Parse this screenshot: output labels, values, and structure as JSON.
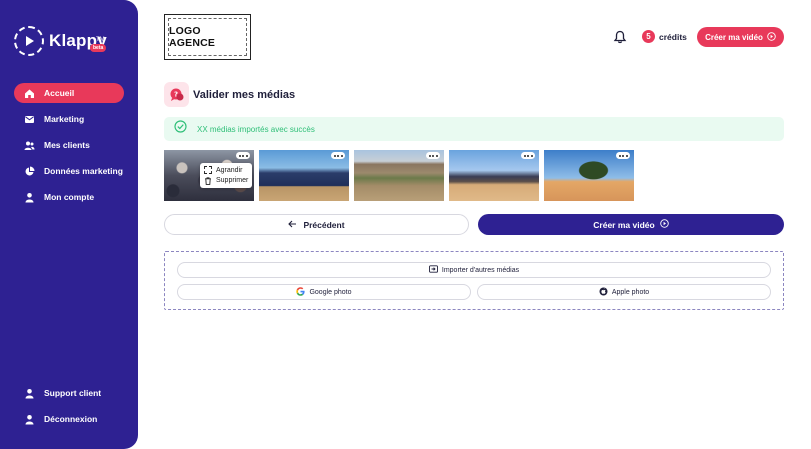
{
  "app": {
    "brand": "Klappy",
    "brand_tm": "TM",
    "brand_badge": "beta"
  },
  "sidebar": {
    "items": [
      {
        "label": "Accueil",
        "icon": "home-icon",
        "active": true
      },
      {
        "label": "Marketing",
        "icon": "mail-icon",
        "active": false
      },
      {
        "label": "Mes clients",
        "icon": "users-icon",
        "active": false
      },
      {
        "label": "Données marketing",
        "icon": "pie-chart-icon",
        "active": false
      },
      {
        "label": "Mon compte",
        "icon": "user-icon",
        "active": false
      }
    ],
    "bottom_items": [
      {
        "label": "Support client",
        "icon": "user-icon"
      },
      {
        "label": "Déconnexion",
        "icon": "user-icon"
      }
    ]
  },
  "header": {
    "agency_logo": "LOGO AGENCE",
    "credits_count": "5",
    "credits_label": "crédits",
    "create_button": "Créer ma vidéo"
  },
  "main": {
    "title": "Valider mes médias",
    "banner": "XX médias importés avec succès",
    "media_menu": {
      "items": [
        "Agrandir",
        "Supprimer"
      ]
    },
    "prev_button": "Précédent",
    "create_button": "Créer ma vidéo",
    "import": {
      "more_button": "Importer d'autres médias",
      "google_button": "Google photo",
      "apple_button": "Apple photo"
    }
  },
  "colors": {
    "sidebar": "#2e2192",
    "accent": "#e8395a",
    "success": "#2fbf78",
    "success_bg": "#e9faf1"
  }
}
